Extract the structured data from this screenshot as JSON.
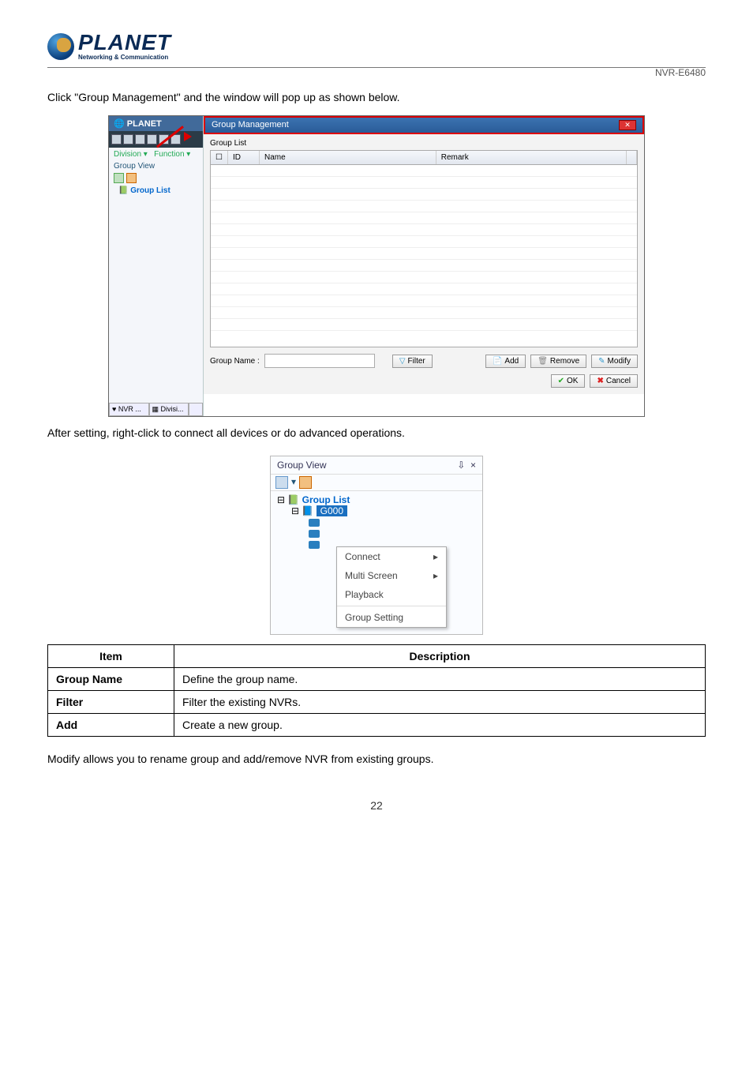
{
  "header": {
    "brand": "PLANET",
    "tagline": "Networking & Communication",
    "model": "NVR-E6480"
  },
  "intro": "Click \"Group Management\" and the window will pop up as shown below.",
  "ss1": {
    "brand": "PLANET",
    "division": "Division",
    "function": "Function",
    "groupView": "Group View",
    "groupList": "Group List",
    "tabNvr": "NVR ...",
    "tabDiv": "Divisi...",
    "title": "Group Management",
    "glLabel": "Group List",
    "colCheck": "",
    "colId": "ID",
    "colName": "Name",
    "colRemark": "Remark",
    "groupName": "Group Name :",
    "filter": "Filter",
    "add": "Add",
    "remove": "Remove",
    "modify": "Modify",
    "ok": "OK",
    "cancel": "Cancel"
  },
  "after1": "After setting, right-click to connect all devices or do advanced operations.",
  "ctx": {
    "header": "Group View",
    "pin": "⇩",
    "close": "×",
    "groupList": "Group List",
    "g000": "G000",
    "menu": {
      "connect": "Connect",
      "multi": "Multi Screen",
      "playback": "Playback",
      "setting": "Group Setting"
    }
  },
  "table": {
    "h1": "Item",
    "h2": "Description",
    "r1a": "Group Name",
    "r1b": "Define the group name.",
    "r2a": "Filter",
    "r2b": "Filter the existing NVRs.",
    "r3a": "Add",
    "r3b": "Create a new group."
  },
  "modify": "Modify allows you to rename group and add/remove NVR from existing groups.",
  "pageNum": "22"
}
